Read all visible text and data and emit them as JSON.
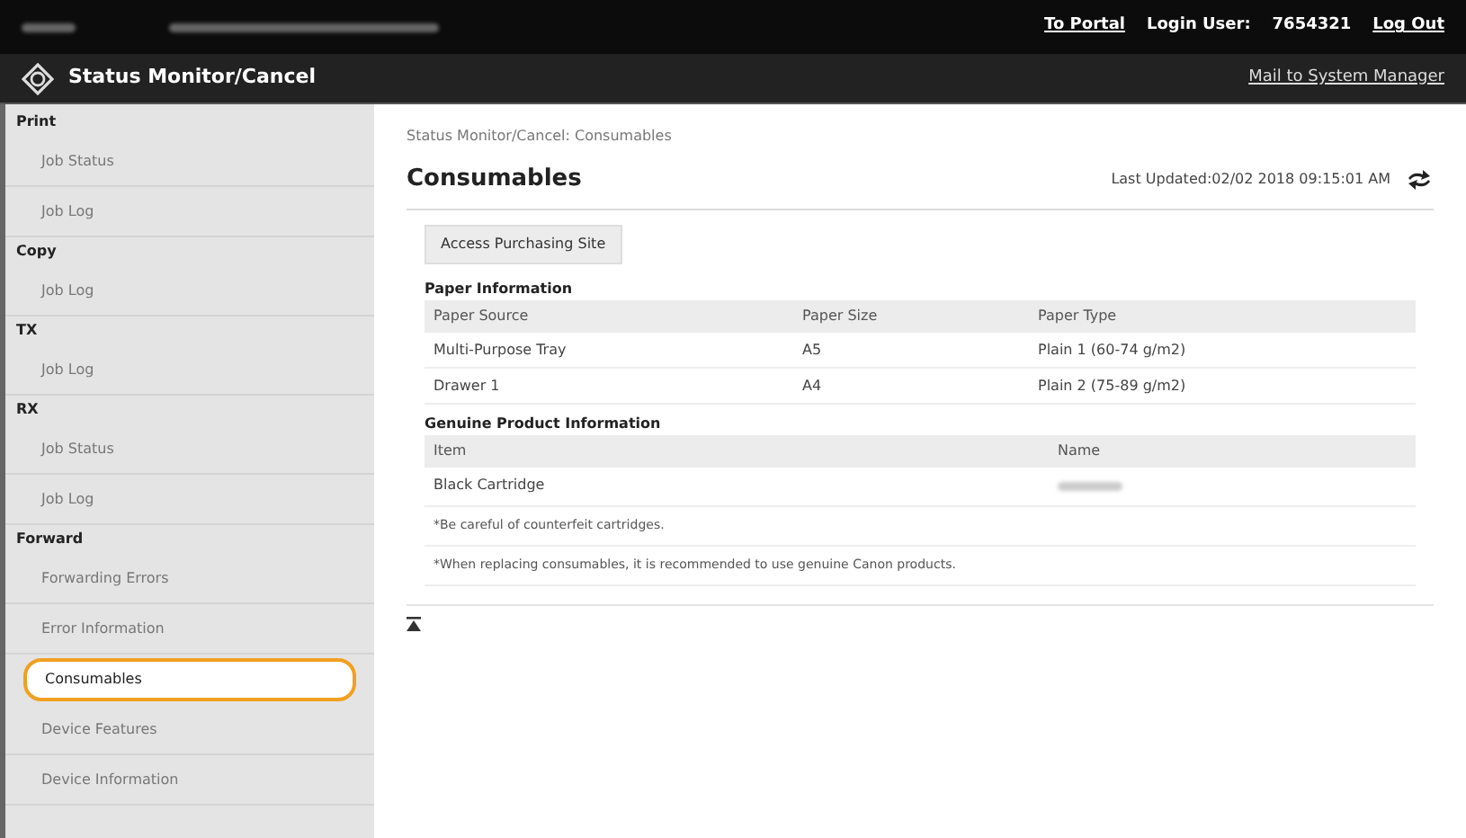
{
  "top_bar": {
    "links": [
      {
        "label": "To Portal",
        "kind": "link"
      },
      {
        "label": "Login User:",
        "kind": "text"
      },
      {
        "label": "7654321",
        "kind": "text"
      },
      {
        "label": "Log Out",
        "kind": "link"
      }
    ]
  },
  "header": {
    "title": "Status Monitor/Cancel",
    "mail_link": "Mail to System Manager"
  },
  "sidebar": {
    "sections": [
      {
        "title": "Print",
        "items": [
          {
            "label": "Job Status",
            "selected": false
          },
          {
            "label": "Job Log",
            "selected": false
          }
        ]
      },
      {
        "title": "Copy",
        "items": [
          {
            "label": "Job Log",
            "selected": false
          }
        ]
      },
      {
        "title": "TX",
        "items": [
          {
            "label": "Job Log",
            "selected": false
          }
        ]
      },
      {
        "title": "RX",
        "items": [
          {
            "label": "Job Status",
            "selected": false
          },
          {
            "label": "Job Log",
            "selected": false
          }
        ]
      },
      {
        "title": "Forward",
        "items": [
          {
            "label": "Forwarding Errors",
            "selected": false
          },
          {
            "label": "Error Information",
            "selected": false
          },
          {
            "label": "Consumables",
            "selected": true
          },
          {
            "label": "Device Features",
            "selected": false
          },
          {
            "label": "Device Information",
            "selected": false
          }
        ]
      }
    ]
  },
  "breadcrumb": "Status Monitor/Cancel: Consumables",
  "page_title": "Consumables",
  "last_updated": "Last Updated:02/02 2018 09:15:01 AM",
  "purchase_button": "Access Purchasing Site",
  "paper_info": {
    "title": "Paper Information",
    "columns": [
      "Paper Source",
      "Paper Size",
      "Paper Type"
    ],
    "rows": [
      [
        "Multi-Purpose Tray",
        "A5",
        "Plain 1 (60-74 g/m2)"
      ],
      [
        "Drawer 1",
        "A4",
        "Plain 2 (75-89 g/m2)"
      ]
    ]
  },
  "genuine_info": {
    "title": "Genuine Product Information",
    "columns": [
      "Item",
      "Name"
    ],
    "rows": [
      [
        "Black Cartridge",
        ""
      ]
    ]
  },
  "notes": [
    "*Be careful of counterfeit cartridges.",
    "*When replacing consumables, it is recommended to use genuine Canon products."
  ]
}
